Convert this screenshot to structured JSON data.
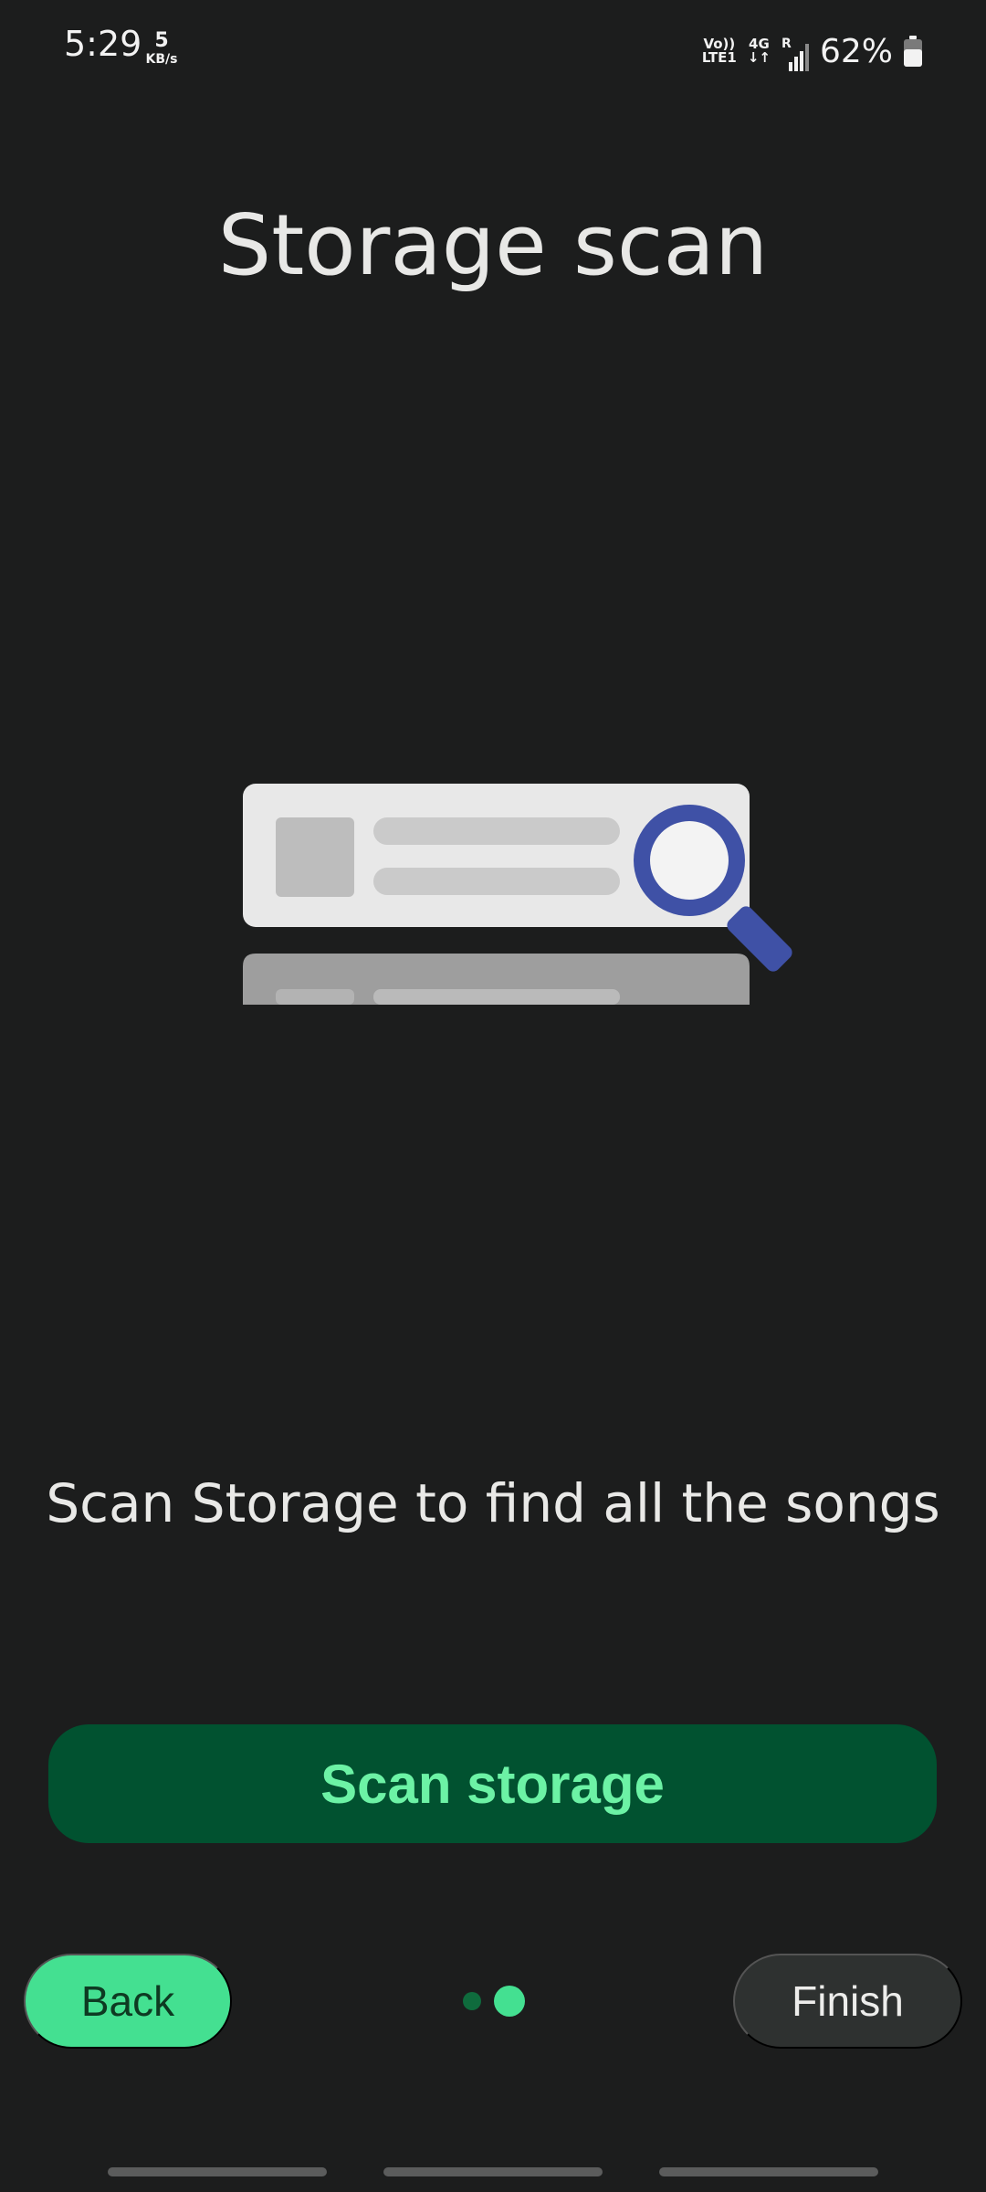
{
  "status_bar": {
    "time": "5:29",
    "net_speed_value": "5",
    "net_speed_unit": "KB/s",
    "volte_top": "Vo))",
    "volte_bottom": "LTE1",
    "network_type": "4G",
    "network_arrows": "↓↑",
    "roaming": "R",
    "battery_percent": "62%",
    "battery_level": 0.62
  },
  "title": "Storage scan",
  "illustration": {
    "icon": "storage-search-illustration",
    "accent_color": "#3f51a6"
  },
  "description": "Scan Storage to find all the songs",
  "scan_button_label": "Scan storage",
  "nav": {
    "back_label": "Back",
    "finish_label": "Finish",
    "page_count": 2,
    "current_page": 2
  },
  "colors": {
    "background": "#1c1d1d",
    "primary": "#44e091",
    "primary_dark": "#015230",
    "primary_text_on_dark": "#6cf2a5"
  }
}
